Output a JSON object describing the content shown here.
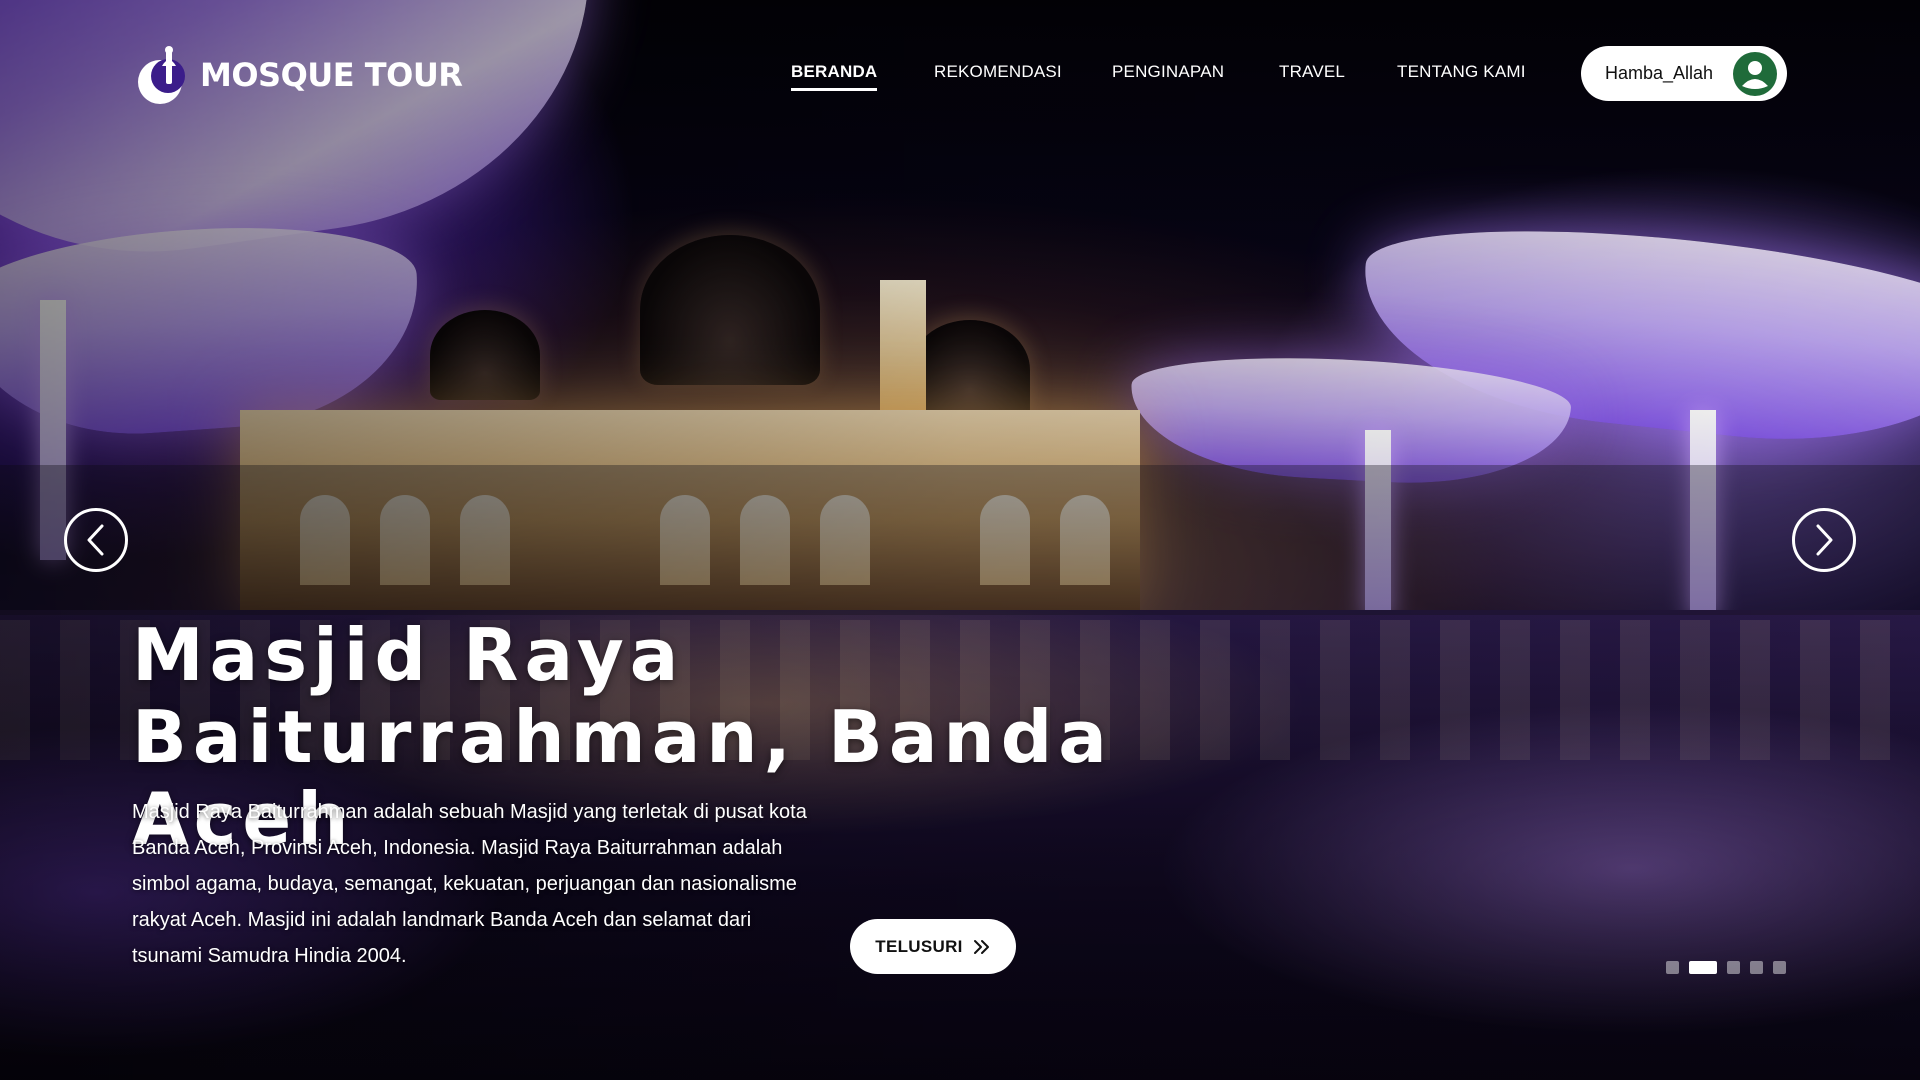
{
  "brand": {
    "name": "MOSQUE TOUR",
    "icon": "mosque-logo-icon"
  },
  "nav": {
    "items": [
      {
        "label": "BERANDA",
        "active": true
      },
      {
        "label": "REKOMENDASI",
        "active": false
      },
      {
        "label": "PENGINAPAN",
        "active": false
      },
      {
        "label": "TRAVEL",
        "active": false
      },
      {
        "label": "TENTANG KAMI",
        "active": false
      }
    ]
  },
  "user": {
    "name": "Hamba_Allah",
    "icon": "user-avatar-icon"
  },
  "hero": {
    "title_line1": "Masjid Raya",
    "title_line2": "Baiturrahman, Banda Aceh",
    "description": "Masjid Raya Baiturrahman adalah sebuah Masjid yang terletak di pusat kota Banda Aceh, Provinsi Aceh, Indonesia. Masjid Raya Baiturrahman adalah simbol agama, budaya, semangat, kekuatan, perjuangan dan nasionalisme rakyat Aceh. Masjid ini adalah landmark Banda Aceh dan selamat dari tsunami Samudra Hindia 2004.",
    "cta_label": "TELUSURI",
    "cta_icon": "double-chevron-right-icon"
  },
  "carousel": {
    "prev_icon": "chevron-left-icon",
    "next_icon": "chevron-right-icon",
    "slide_count": 5,
    "active_slide": 2
  },
  "colors": {
    "accent": "#ffffff",
    "avatar": "#1f6b3a"
  }
}
